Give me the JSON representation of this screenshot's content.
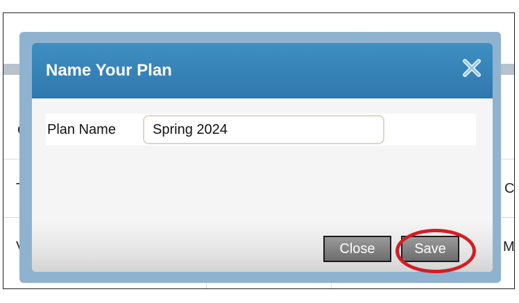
{
  "background": {
    "letter_c1": "C",
    "letter_t": "T",
    "letter_v": "V",
    "letter_c2": "C",
    "letter_m": "M"
  },
  "dialog": {
    "title": "Name Your Plan",
    "close_icon": "close-x-icon",
    "plan_name_label": "Plan Name",
    "plan_name_value": "Spring 2024",
    "close_button": "Close",
    "save_button": "Save"
  },
  "colors": {
    "title_bar": "#3f8fc2",
    "annotation": "#d61c24"
  }
}
